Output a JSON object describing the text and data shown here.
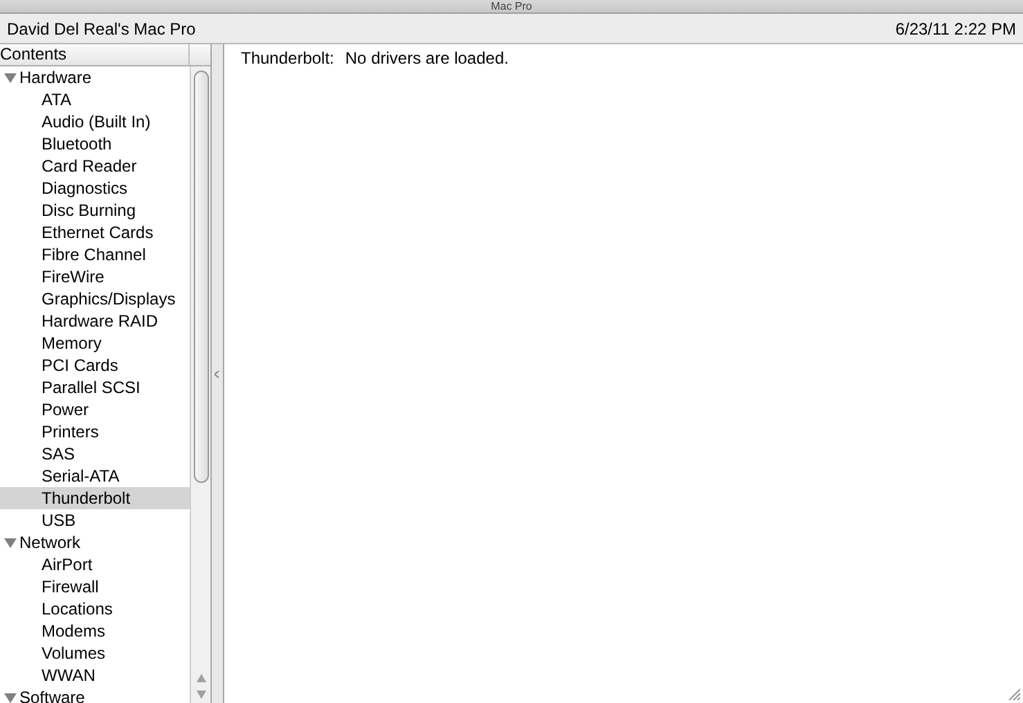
{
  "window": {
    "title": "Mac Pro"
  },
  "header": {
    "computer_name": "David Del Real's Mac Pro",
    "date": "6/23/11 2:22 PM"
  },
  "sidebar": {
    "heading": "Contents",
    "items": [
      {
        "label": "Hardware",
        "expanded": true,
        "selected": false,
        "children": [
          {
            "label": "ATA",
            "selected": false
          },
          {
            "label": "Audio (Built In)",
            "selected": false
          },
          {
            "label": "Bluetooth",
            "selected": false
          },
          {
            "label": "Card Reader",
            "selected": false
          },
          {
            "label": "Diagnostics",
            "selected": false
          },
          {
            "label": "Disc Burning",
            "selected": false
          },
          {
            "label": "Ethernet Cards",
            "selected": false
          },
          {
            "label": "Fibre Channel",
            "selected": false
          },
          {
            "label": "FireWire",
            "selected": false
          },
          {
            "label": "Graphics/Displays",
            "selected": false
          },
          {
            "label": "Hardware RAID",
            "selected": false
          },
          {
            "label": "Memory",
            "selected": false
          },
          {
            "label": "PCI Cards",
            "selected": false
          },
          {
            "label": "Parallel SCSI",
            "selected": false
          },
          {
            "label": "Power",
            "selected": false
          },
          {
            "label": "Printers",
            "selected": false
          },
          {
            "label": "SAS",
            "selected": false
          },
          {
            "label": "Serial-ATA",
            "selected": false
          },
          {
            "label": "Thunderbolt",
            "selected": true
          },
          {
            "label": "USB",
            "selected": false
          }
        ]
      },
      {
        "label": "Network",
        "expanded": true,
        "selected": false,
        "children": [
          {
            "label": "AirPort",
            "selected": false
          },
          {
            "label": "Firewall",
            "selected": false
          },
          {
            "label": "Locations",
            "selected": false
          },
          {
            "label": "Modems",
            "selected": false
          },
          {
            "label": "Volumes",
            "selected": false
          },
          {
            "label": "WWAN",
            "selected": false
          }
        ]
      },
      {
        "label": "Software",
        "expanded": true,
        "selected": false
      }
    ]
  },
  "content": {
    "label": "Thunderbolt:",
    "message": "No drivers are loaded."
  }
}
